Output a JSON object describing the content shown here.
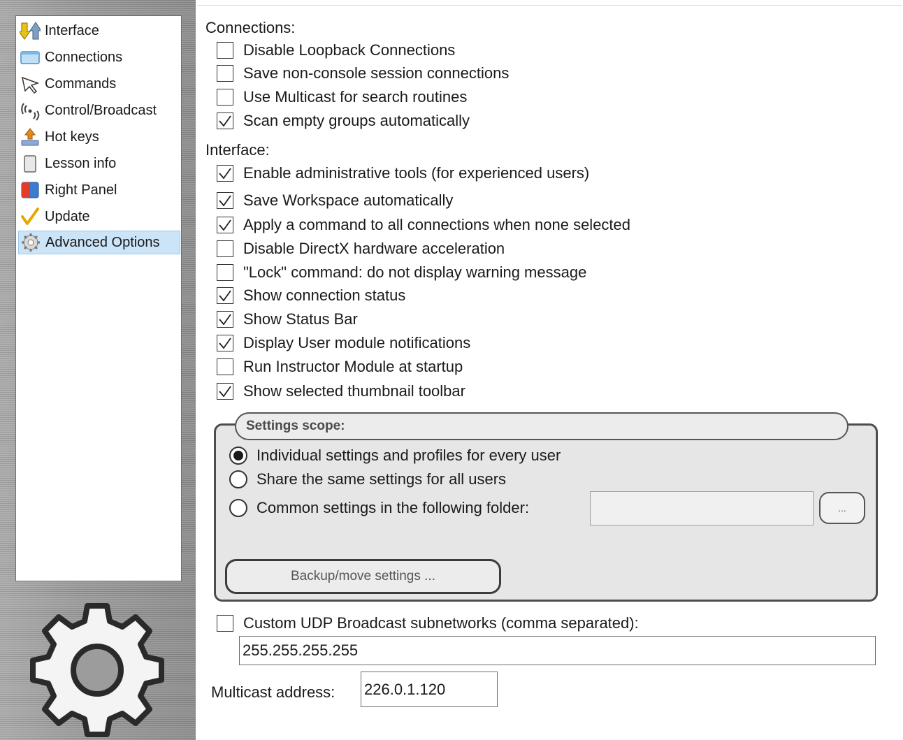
{
  "sidebar": {
    "items": [
      {
        "label": "Interface",
        "icon": "interface-arrows-icon"
      },
      {
        "label": "Connections",
        "icon": "connections-window-icon"
      },
      {
        "label": "Commands",
        "icon": "cursor-arrow-icon"
      },
      {
        "label": "Control/Broadcast",
        "icon": "broadcast-signal-icon"
      },
      {
        "label": "Hot keys",
        "icon": "hotkeys-icon"
      },
      {
        "label": "Lesson info",
        "icon": "lesson-page-icon"
      },
      {
        "label": "Right Panel",
        "icon": "right-panel-icon"
      },
      {
        "label": "Update",
        "icon": "checkmark-icon"
      },
      {
        "label": "Advanced Options",
        "icon": "gear-icon"
      }
    ],
    "selected": "Advanced Options"
  },
  "connections": {
    "title": "Connections:",
    "options": [
      {
        "label": "Disable Loopback Connections",
        "checked": false
      },
      {
        "label": "Save non-console session connections",
        "checked": false
      },
      {
        "label": "Use Multicast for search routines",
        "checked": false
      },
      {
        "label": "Scan empty groups automatically",
        "checked": true
      }
    ]
  },
  "interface": {
    "title": "Interface:",
    "options": [
      {
        "label": "Enable administrative tools (for experienced users)",
        "checked": true
      },
      {
        "label": "Save Workspace automatically",
        "checked": true
      },
      {
        "label": "Apply a command to all connections when none selected",
        "checked": true
      },
      {
        "label": "Disable DirectX hardware acceleration",
        "checked": false
      },
      {
        "label": "\"Lock\" command: do not display warning message",
        "checked": false
      },
      {
        "label": "Show connection status",
        "checked": true
      },
      {
        "label": "Show Status Bar",
        "checked": true
      },
      {
        "label": "Display User module notifications",
        "checked": true
      },
      {
        "label": "Run Instructor Module at startup",
        "checked": false
      },
      {
        "label": "Show selected thumbnail toolbar",
        "checked": true
      }
    ]
  },
  "settings_scope": {
    "title": "Settings scope:",
    "options": [
      {
        "label": "Individual settings and profiles for every user",
        "selected": true
      },
      {
        "label": "Share the same settings for all users",
        "selected": false
      },
      {
        "label": "Common settings in the following folder:",
        "selected": false
      }
    ],
    "folder_value": "",
    "browse_label": "...",
    "backup_label": "Backup/move settings ..."
  },
  "udp": {
    "label": "Custom UDP Broadcast subnetworks (comma separated):",
    "checked": false,
    "value": "255.255.255.255"
  },
  "multicast": {
    "label": "Multicast address:",
    "value": "226.0.1.120"
  },
  "colors": {
    "selection_bg": "#cce4f7",
    "selection_border": "#99c9ef",
    "group_bg": "#e6e6e6"
  }
}
